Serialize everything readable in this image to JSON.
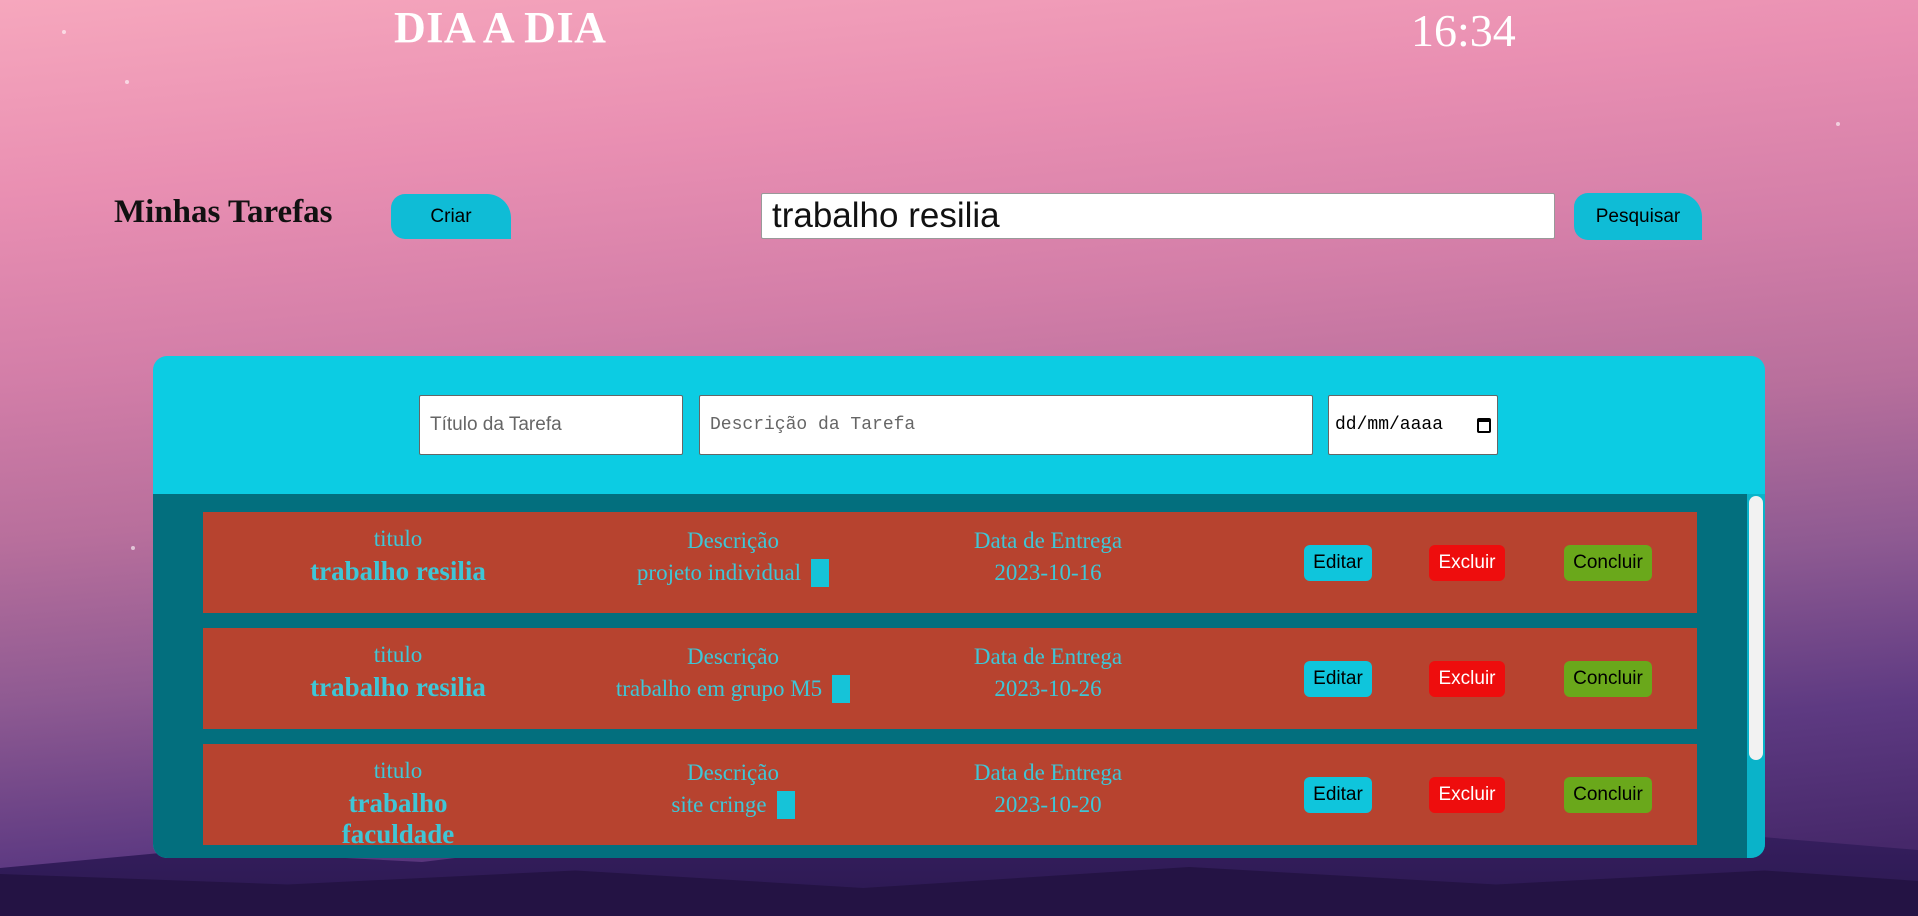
{
  "header": {
    "app_title": "DIA A DIA",
    "clock": "16:34"
  },
  "toolbar": {
    "section_title": "Minhas Tarefas",
    "create_label": "Criar",
    "search_value": "trabalho resilia",
    "search_label": "Pesquisar"
  },
  "form": {
    "title_placeholder": "Título da Tarefa",
    "description_placeholder": "Descrição da Tarefa",
    "date_placeholder": "dd/mm/aaaa"
  },
  "task_labels": {
    "title_label": "titulo",
    "description_label": "Descrição",
    "date_label": "Data de Entrega",
    "edit_label": "Editar",
    "delete_label": "Excluir",
    "complete_label": "Concluir"
  },
  "tasks": [
    {
      "title": "trabalho resilia",
      "description": "projeto individual",
      "due_date": "2023-10-16"
    },
    {
      "title": "trabalho resilia",
      "description": "trabalho em grupo M5",
      "due_date": "2023-10-26"
    },
    {
      "title": "trabalho faculdade",
      "description": "site cringe",
      "due_date": "2023-10-20"
    }
  ],
  "colors": {
    "accent": "#0ccce3",
    "task_bg": "#b7432f",
    "delete": "#ee0d0d",
    "complete": "#6aa81b"
  }
}
